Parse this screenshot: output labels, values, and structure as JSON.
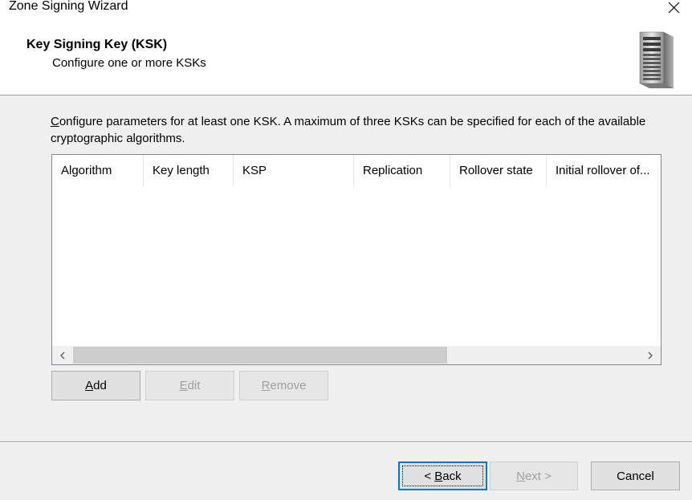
{
  "window": {
    "title": "Zone Signing Wizard",
    "close_icon": "close-icon"
  },
  "header": {
    "title": "Key Signing Key (KSK)",
    "subtitle": "Configure one or more KSKs",
    "icon": "server-icon"
  },
  "description": {
    "first_letter": "C",
    "rest": "onfigure parameters for at least one KSK. A maximum of three KSKs can be specified for each of the available cryptographic algorithms."
  },
  "listview": {
    "columns": [
      "Algorithm",
      "Key length",
      "KSP",
      "Replication",
      "Rollover state",
      "Initial rollover of..."
    ],
    "rows": [],
    "scroll_left_icon": "chevron-left-icon",
    "scroll_right_icon": "chevron-right-icon"
  },
  "list_buttons": {
    "add": {
      "mnemonic": "A",
      "rest": "dd"
    },
    "edit": {
      "mnemonic": "E",
      "rest": "dit"
    },
    "remove": {
      "mnemonic": "R",
      "rest": "emove"
    }
  },
  "footer_buttons": {
    "back": {
      "prefix": "< ",
      "mnemonic": "B",
      "rest": "ack"
    },
    "next": {
      "mnemonic": "N",
      "rest": "ext >"
    },
    "cancel": "Cancel"
  },
  "colors": {
    "accent": "#0078d7",
    "window_bg": "#f0f0f0",
    "disabled_text": "#a0a0a0"
  }
}
